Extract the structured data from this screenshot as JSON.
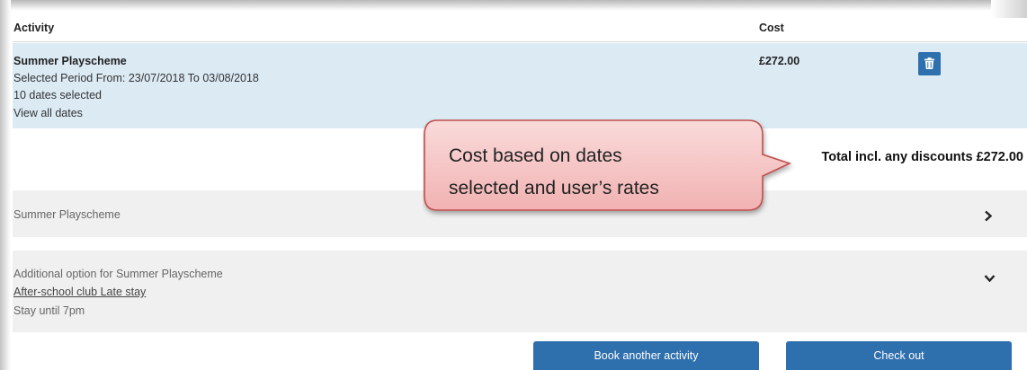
{
  "table": {
    "header_activity": "Activity",
    "header_cost": "Cost"
  },
  "booking": {
    "title": "Summer Playscheme",
    "period": "Selected Period From: 23/07/2018 To 03/08/2018",
    "dates_selected": "10 dates selected",
    "view_all": "View all dates",
    "cost": "£272.00",
    "delete_icon": "trash-icon"
  },
  "total": "Total incl. any discounts £272.00",
  "panels": [
    {
      "title": "Summer Playscheme",
      "chevron_icon": "chevron-right-icon"
    },
    {
      "title": "Additional option for Summer Playscheme",
      "link": "After-school club Late stay",
      "note": "Stay until 7pm",
      "chevron_icon": "chevron-down-icon"
    }
  ],
  "buttons": {
    "book_another": "Book another activity",
    "check_out": "Check out"
  },
  "callout": {
    "line1": "Cost based on dates",
    "line2": "selected and user’s rates"
  },
  "colors": {
    "primary_button": "#2e6fad",
    "selected_row": "#dceaf4",
    "panel_background": "#f0f0f0",
    "callout_fill": "#f6c6c6",
    "callout_border": "#c0504d"
  }
}
